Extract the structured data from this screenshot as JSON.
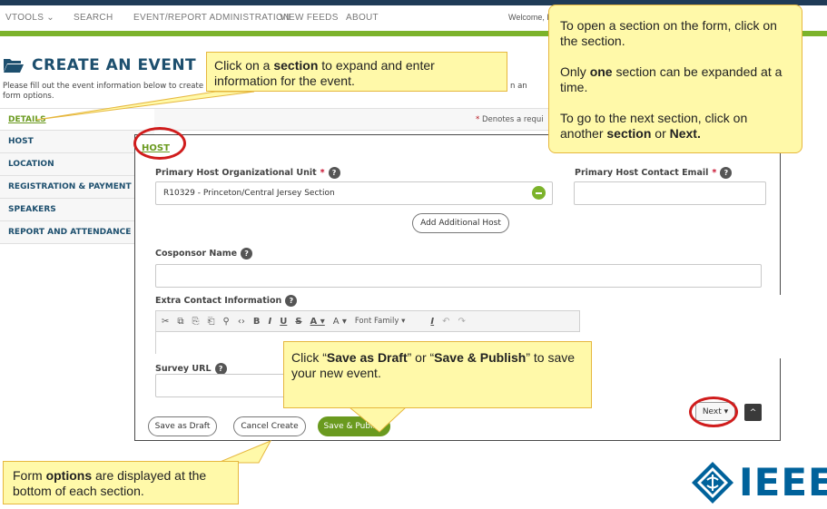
{
  "nav": {
    "items": [
      "VTOOLS",
      "SEARCH",
      "EVENT/REPORT ADMINISTRATION",
      "VIEW FEEDS",
      "ABOUT"
    ],
    "welcome": "Welcome, K"
  },
  "page": {
    "title": "CREATE AN EVENT",
    "intro": "Please fill out the event information below to create",
    "intro_line2": "form options.",
    "intro_tail": "n an",
    "required_star": "* ",
    "required_rest": "Denotes a requi"
  },
  "sections": {
    "items": [
      "DETAILS",
      "HOST",
      "LOCATION",
      "REGISTRATION & PAYMENT",
      "SPEAKERS",
      "REPORT AND ATTENDANCE"
    ]
  },
  "form": {
    "heading": "HOST",
    "primary_host_label": "Primary Host Organizational Unit",
    "primary_host_value": "R10329 - Princeton/Central Jersey Section",
    "contact_email_label": "Primary Host Contact Email",
    "required_marker": "*",
    "help": "?",
    "add_host": "Add Additional Host",
    "cosponsor_label": "Cosponsor Name",
    "extra_contact_label": "Extra Contact Information",
    "font_family": "Font Family",
    "survey_label": "Survey URL",
    "save_draft": "Save as Draft",
    "cancel_create": "Cancel Create",
    "save_publish": "Save & Publish",
    "next": "Next",
    "next_caret": "▾",
    "top_arrow": "^"
  },
  "toolbar": {
    "cut": "✂",
    "copy": "⧉",
    "paste": "⎘",
    "paste_text": "⎗",
    "link": "⚲",
    "source": "‹›",
    "bold": "B",
    "italic": "I",
    "underline": "U",
    "strike": "S",
    "font_color": "A ▾",
    "bg_color": "A ▾",
    "font_caret": "▾",
    "clear_format": "I",
    "undo": "↶",
    "redo": "↷"
  },
  "callouts": {
    "section_tip_pre": "Click on a ",
    "section_tip_bold": "section",
    "section_tip_post": " to expand and enter information for the event.",
    "open_tip_1": "To open a section on the form, click on the section.",
    "open_tip_2_pre": "Only ",
    "open_tip_2_bold": "one",
    "open_tip_2_post": " section can be expanded at a time.",
    "open_tip_3_pre": "To go to the next section, click on another ",
    "open_tip_3_bold1": "section",
    "open_tip_3_mid": " or ",
    "open_tip_3_bold2": "Next.",
    "save_tip_pre": "Click “",
    "save_tip_bold1": "Save as Draft",
    "save_tip_mid": "” or “",
    "save_tip_bold2": "Save & Publish",
    "save_tip_post": "” to save your new event.",
    "options_tip_pre": "Form ",
    "options_tip_bold": "options",
    "options_tip_post": " are displayed at the bottom of each section."
  },
  "logo": {
    "text": "IEEE"
  },
  "colors": {
    "navy": "#1f3b57",
    "green": "#7cb32b",
    "link_green": "#6a9a1f",
    "title_blue": "#1d4f6e",
    "callout_fill": "#fff9a9",
    "callout_border": "#e6b73e",
    "highlight_red": "#d01c1c",
    "ieee_blue": "#00629b"
  }
}
